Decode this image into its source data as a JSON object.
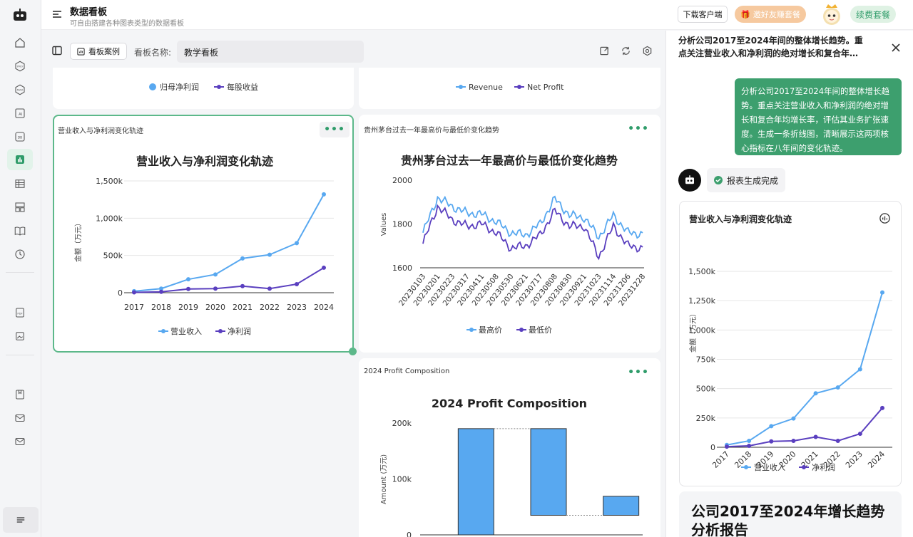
{
  "header": {
    "title": "数据看板",
    "subtitle": "可自由搭建各种图表类型的数据看板",
    "download_label": "下载客户端",
    "invite_label": "邀好友赚套餐",
    "renew_label": "续费套餐"
  },
  "toolbar": {
    "case_label": "看板案例",
    "name_label": "看板名称:",
    "name_value": "教学看板"
  },
  "cards": {
    "top_left": {
      "legend": [
        "归母净利润",
        "每股收益"
      ]
    },
    "top_mid": {
      "legend": [
        "Revenue",
        "Net Profit"
      ]
    },
    "revenue_card": {
      "card_title": "营业收入与净利润变化轨迹",
      "menu": "•••",
      "chart_title": "营业收入与净利润变化轨迹",
      "ylabel": "金额（万元）",
      "yticks": [
        "1,500k",
        "1,000k",
        "500k",
        "0"
      ],
      "legend": [
        "营业收入",
        "净利润"
      ]
    },
    "maotai_card": {
      "card_title": "贵州茅台过去一年最高价与最低价变化趋势",
      "menu": "•••",
      "chart_title": "贵州茅台过去一年最高价与最低价变化趋势",
      "ylabel": "Values",
      "yticks": [
        "2000",
        "1800",
        "1600"
      ],
      "xticks": [
        "20230103",
        "20230201",
        "20230223",
        "20230317",
        "20230411",
        "20230508",
        "20230530",
        "20230621",
        "20230717",
        "20230808",
        "20230830",
        "20230921",
        "20231023",
        "20231114",
        "20231206",
        "20231228"
      ],
      "legend": [
        "最高价",
        "最低价"
      ]
    },
    "profit_card": {
      "card_title": "2024 Profit Composition",
      "menu": "•••",
      "chart_title": "2024 Profit Composition",
      "ylabel": "Amount (万元)",
      "yticks": [
        "200k",
        "100k",
        "0"
      ]
    }
  },
  "chat": {
    "header": "分析公司2017至2024年间的整体增长趋势。重点关注营业收入和净利润的绝对增长和复合年…",
    "user_message": "分析公司2017至2024年间的整体增长趋势。重点关注营业收入和净利润的绝对增长和复合年均增长率，评估其业务扩张速度。生成一条折线图，清晰展示这两项核心指标在八年间的变化轨迹。",
    "status": "报表生成完成",
    "chart_card_title": "营业收入与净利润变化轨迹",
    "chart_ylabel": "金额（万元）",
    "chart_yticks": [
      "1,500k",
      "1,250k",
      "1,000k",
      "750k",
      "500k",
      "250k",
      "0"
    ],
    "chart_legend": [
      "营业收入",
      "净利润"
    ],
    "report_title": "公司2017至2024年增长趋势分析报告"
  },
  "colors": {
    "accent_green": "#2f9c6a",
    "series_blue": "#58a8f0",
    "series_purple": "#5a3fbf"
  },
  "chart_data": [
    {
      "type": "line",
      "title": "营业收入与净利润变化轨迹",
      "ylabel": "金额（万元）",
      "x": [
        "2017",
        "2018",
        "2019",
        "2020",
        "2021",
        "2022",
        "2023",
        "2024"
      ],
      "series": [
        {
          "name": "营业收入",
          "values": [
            20000,
            55000,
            180000,
            245000,
            460000,
            510000,
            665000,
            1320000
          ]
        },
        {
          "name": "净利润",
          "values": [
            5000,
            12000,
            50000,
            55000,
            88000,
            55000,
            115000,
            335000
          ]
        }
      ],
      "ylim": [
        0,
        1500000
      ]
    },
    {
      "type": "line",
      "title": "贵州茅台过去一年最高价与最低价变化趋势",
      "ylabel": "Values",
      "x": [
        "20230103",
        "20230201",
        "20230223",
        "20230317",
        "20230411",
        "20230508",
        "20230530",
        "20230621",
        "20230717",
        "20230808",
        "20230830",
        "20230921",
        "20231023",
        "20231114",
        "20231206",
        "20231228"
      ],
      "series": [
        {
          "name": "最高价",
          "values": [
            1760,
            1920,
            1880,
            1850,
            1845,
            1810,
            1760,
            1750,
            1800,
            1915,
            1840,
            1830,
            1740,
            1840,
            1760,
            1755
          ]
        },
        {
          "name": "最低价",
          "values": [
            1710,
            1880,
            1820,
            1790,
            1800,
            1760,
            1690,
            1700,
            1750,
            1860,
            1790,
            1790,
            1650,
            1790,
            1700,
            1690
          ]
        }
      ],
      "ylim": [
        1600,
        2000
      ]
    },
    {
      "type": "bar",
      "title": "2024 Profit Composition",
      "ylabel": "Amount (万元)",
      "categories": [
        "",
        "",
        ""
      ],
      "ranges": [
        [
          0,
          190000
        ],
        [
          35000,
          190000
        ],
        [
          35000,
          69000
        ]
      ],
      "ylim": [
        0,
        200000
      ]
    },
    {
      "type": "line",
      "title": "营业收入与净利润变化轨迹",
      "ylabel": "金额（万元）",
      "x": [
        "2017",
        "2018",
        "2019",
        "2020",
        "2021",
        "2022",
        "2023",
        "2024"
      ],
      "series": [
        {
          "name": "营业收入",
          "values": [
            20000,
            55000,
            180000,
            245000,
            460000,
            510000,
            665000,
            1320000
          ]
        },
        {
          "name": "净利润",
          "values": [
            5000,
            12000,
            50000,
            55000,
            88000,
            55000,
            115000,
            335000
          ]
        }
      ],
      "ylim": [
        0,
        1500000
      ]
    }
  ]
}
